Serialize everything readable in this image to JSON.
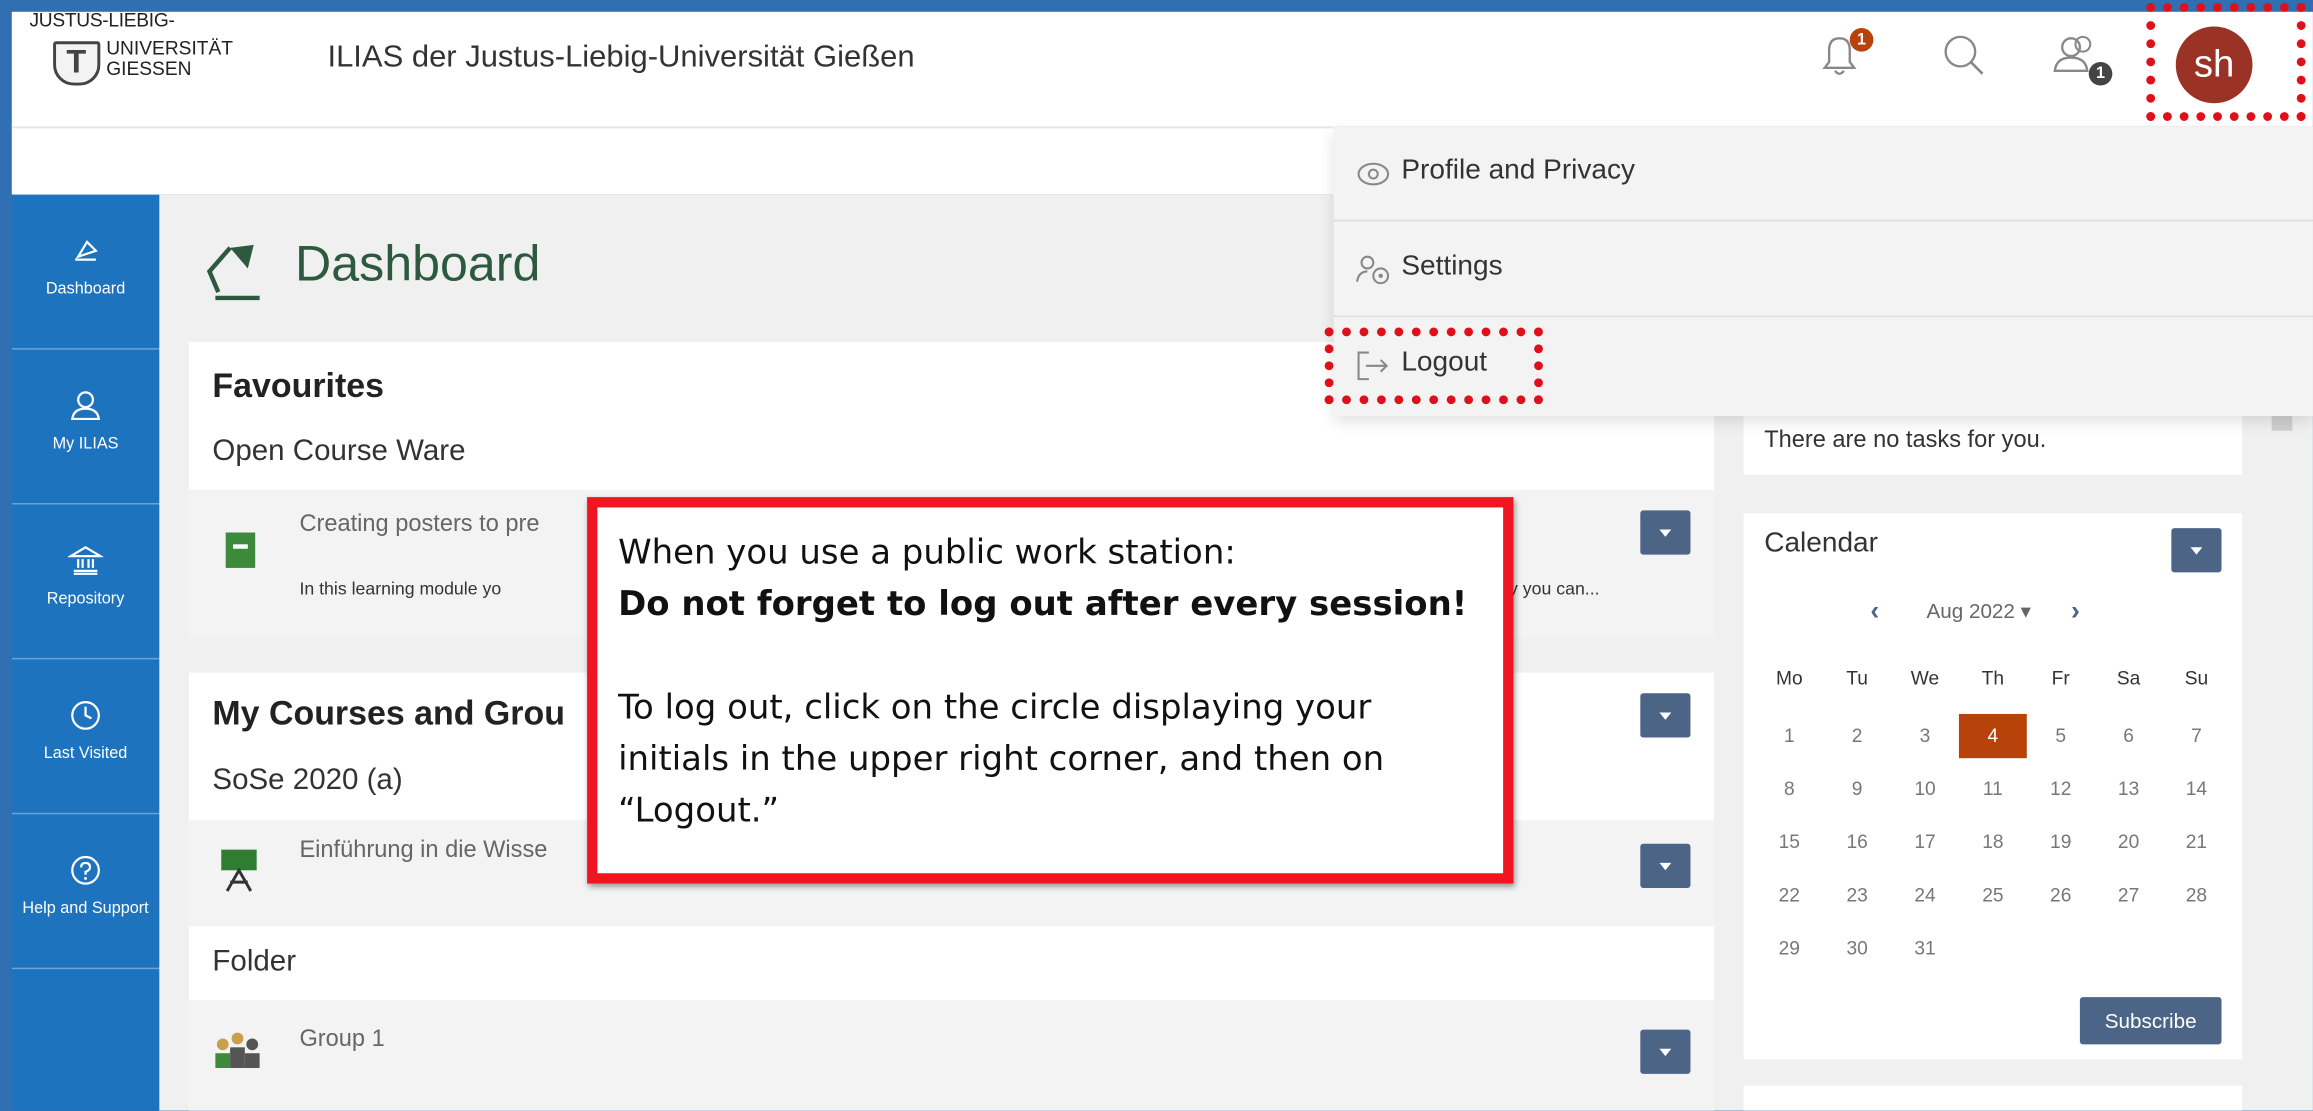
{
  "header": {
    "logo_line1": "JUSTUS-LIEBIG-",
    "logo_line2": "UNIVERSITÄT",
    "logo_line3": "GIESSEN",
    "app_title": "ILIAS der Justus-Liebig-Universität Gießen",
    "notification_count": "1",
    "online_users_count": "1",
    "avatar_initials": "sh"
  },
  "sidebar": {
    "items": [
      {
        "label": "Dashboard",
        "icon": "dashboard-icon"
      },
      {
        "label": "My ILIAS",
        "icon": "person-icon"
      },
      {
        "label": "Repository",
        "icon": "repository-icon"
      },
      {
        "label": "Last Visited",
        "icon": "clock-icon"
      },
      {
        "label": "Help and Support",
        "icon": "help-icon"
      }
    ]
  },
  "page": {
    "title": "Dashboard"
  },
  "favourites": {
    "heading": "Favourites",
    "group": "Open Course Ware",
    "item_title": "Creating posters to pre",
    "item_desc_left": "In this learning module yo",
    "item_desc_right": "y you can..."
  },
  "courses": {
    "heading": "My Courses and Grou",
    "term": "SoSe 2020 (a)",
    "course_title": "Einführung in die Wisse",
    "folder_heading": "Folder",
    "group_title": "Group 1"
  },
  "tasks": {
    "text": "There are no tasks for you."
  },
  "calendar": {
    "title": "Calendar",
    "month": "Aug 2022",
    "weekdays": [
      "Mo",
      "Tu",
      "We",
      "Th",
      "Fr",
      "Sa",
      "Su"
    ],
    "weeks": [
      [
        "1",
        "2",
        "3",
        "4",
        "5",
        "6",
        "7"
      ],
      [
        "8",
        "9",
        "10",
        "11",
        "12",
        "13",
        "14"
      ],
      [
        "15",
        "16",
        "17",
        "18",
        "19",
        "20",
        "21"
      ],
      [
        "22",
        "23",
        "24",
        "25",
        "26",
        "27",
        "28"
      ],
      [
        "29",
        "30",
        "31",
        "",
        "",
        "",
        ""
      ]
    ],
    "today": "4",
    "subscribe_label": "Subscribe"
  },
  "user_menu": {
    "items": [
      {
        "label": "Profile and Privacy",
        "icon": "eye-icon"
      },
      {
        "label": "Settings",
        "icon": "user-settings-icon"
      },
      {
        "label": "Logout",
        "icon": "logout-icon"
      }
    ]
  },
  "callout": {
    "line1": "When you use a public work station:",
    "line2": "Do not forget to log out after every session!",
    "line3": "To log out, click on the circle displaying your",
    "line4": "initials in the upper right corner, and then on",
    "line5": "“Logout.”"
  },
  "colors": {
    "brand_blue": "#1e73be",
    "avatar": "#9b3226",
    "highlight_red": "#e0101a",
    "today": "#b7430a",
    "dropdown_button": "#4c6586"
  }
}
